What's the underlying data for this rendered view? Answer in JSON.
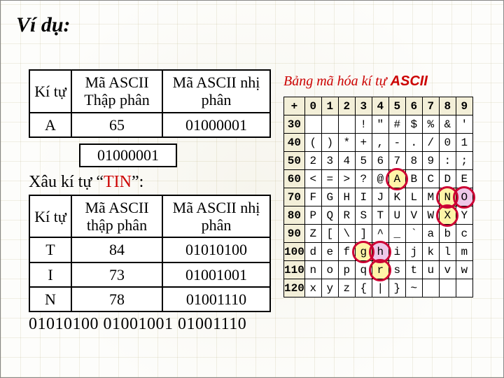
{
  "title": "Ví dụ:",
  "table1": {
    "headers": [
      "Kí tự",
      "Mã ASCII Thập phân",
      "Mã  ASCII nhị phân"
    ],
    "rows": [
      {
        "char": "A",
        "dec": "65",
        "bin": "01000001"
      }
    ]
  },
  "callout_bin": "01000001",
  "subhead_prefix": "Xâu kí tự ",
  "subhead_quote_open": "“",
  "subhead_tin": "TIN",
  "subhead_quote_close": "”:",
  "table2": {
    "headers": [
      "Kí tự",
      "Mã ASCII thập phân",
      "Mã ASCII nhị phân"
    ],
    "rows": [
      {
        "char": "T",
        "dec": "84",
        "bin": "01010100"
      },
      {
        "char": "I",
        "dec": "73",
        "bin": "01001001"
      },
      {
        "char": "N",
        "dec": "78",
        "bin": "01001110"
      }
    ]
  },
  "bottom_bits": "01010100 01001001 01001110",
  "chart_title_prefix": "Bảng mã hóa kí tự ",
  "chart_title_ascii": "ASCII",
  "ascii_chart": {
    "col_headers": [
      "+",
      "0",
      "1",
      "2",
      "3",
      "4",
      "5",
      "6",
      "7",
      "8",
      "9"
    ],
    "rows": [
      {
        "h": "30",
        "c": [
          "",
          "",
          "",
          "!",
          "\"",
          "#",
          "$",
          "%",
          "&",
          "'"
        ]
      },
      {
        "h": "40",
        "c": [
          "(",
          ")",
          "*",
          "+",
          ",",
          "-",
          ".",
          "/",
          "0",
          "1"
        ]
      },
      {
        "h": "50",
        "c": [
          "2",
          "3",
          "4",
          "5",
          "6",
          "7",
          "8",
          "9",
          ":",
          ";"
        ]
      },
      {
        "h": "60",
        "c": [
          "<",
          "=",
          ">",
          "?",
          "@",
          "A",
          "B",
          "C",
          "D",
          "E"
        ]
      },
      {
        "h": "70",
        "c": [
          "F",
          "G",
          "H",
          "I",
          "J",
          "K",
          "L",
          "M",
          "N",
          "O"
        ]
      },
      {
        "h": "80",
        "c": [
          "P",
          "Q",
          "R",
          "S",
          "T",
          "U",
          "V",
          "W",
          "X",
          "Y"
        ]
      },
      {
        "h": "90",
        "c": [
          "Z",
          "[",
          "\\",
          "]",
          "^",
          "_",
          "`",
          "a",
          "b",
          "c"
        ]
      },
      {
        "h": "100",
        "c": [
          "d",
          "e",
          "f",
          "g",
          "h",
          "i",
          "j",
          "k",
          "l",
          "m"
        ]
      },
      {
        "h": "110",
        "c": [
          "n",
          "o",
          "p",
          "q",
          "r",
          "s",
          "t",
          "u",
          "v",
          "w"
        ]
      },
      {
        "h": "120",
        "c": [
          "x",
          "y",
          "z",
          "{",
          "|",
          "}",
          "~",
          "",
          "",
          ""
        ]
      }
    ],
    "highlight_yellow": [
      [
        3,
        5
      ],
      [
        4,
        8
      ],
      [
        5,
        8
      ],
      [
        7,
        3
      ],
      [
        8,
        4
      ]
    ],
    "highlight_pink": [
      [
        4,
        9
      ],
      [
        7,
        4
      ]
    ],
    "circled": [
      [
        4,
        9
      ],
      [
        7,
        4
      ],
      [
        3,
        5
      ],
      [
        4,
        8
      ],
      [
        5,
        8
      ],
      [
        7,
        3
      ],
      [
        8,
        4
      ]
    ]
  }
}
